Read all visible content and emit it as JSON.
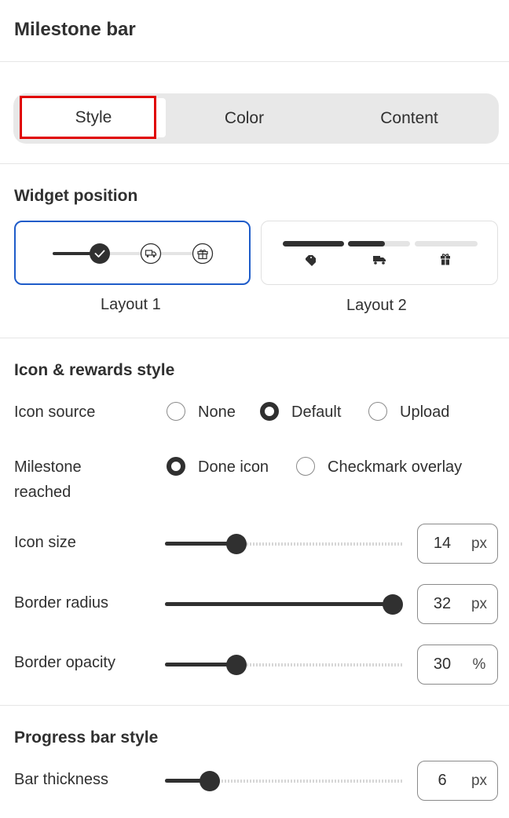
{
  "header": {
    "title": "Milestone bar"
  },
  "tabs": [
    {
      "label": "Style",
      "active": true
    },
    {
      "label": "Color",
      "active": false
    },
    {
      "label": "Content",
      "active": false
    }
  ],
  "widget_position": {
    "title": "Widget position",
    "layouts": [
      {
        "label": "Layout 1",
        "selected": true
      },
      {
        "label": "Layout 2",
        "selected": false
      }
    ]
  },
  "icon_rewards": {
    "title": "Icon & rewards style",
    "icon_source": {
      "label": "Icon source",
      "options": [
        {
          "label": "None",
          "selected": false
        },
        {
          "label": "Default",
          "selected": true
        },
        {
          "label": "Upload",
          "selected": false
        }
      ]
    },
    "milestone_reached": {
      "label_line1": "Milestone",
      "label_line2": "reached",
      "options": [
        {
          "label": "Done icon",
          "selected": true
        },
        {
          "label": "Checkmark overlay",
          "selected": false
        }
      ]
    },
    "icon_size": {
      "label": "Icon size",
      "value": "14",
      "unit": "px",
      "fraction": 0.3
    },
    "border_radius": {
      "label": "Border radius",
      "value": "32",
      "unit": "px",
      "fraction": 0.96
    },
    "border_opacity": {
      "label": "Border opacity",
      "value": "30",
      "unit": "%",
      "fraction": 0.3
    }
  },
  "progress_bar": {
    "title": "Progress bar style",
    "bar_thickness": {
      "label": "Bar thickness",
      "value": "6",
      "unit": "px",
      "fraction": 0.19
    }
  },
  "colors": {
    "text": "#303030",
    "selected_border": "#1f5cc9",
    "tab_bg": "#e8e8e8",
    "highlight": "#e00000"
  }
}
